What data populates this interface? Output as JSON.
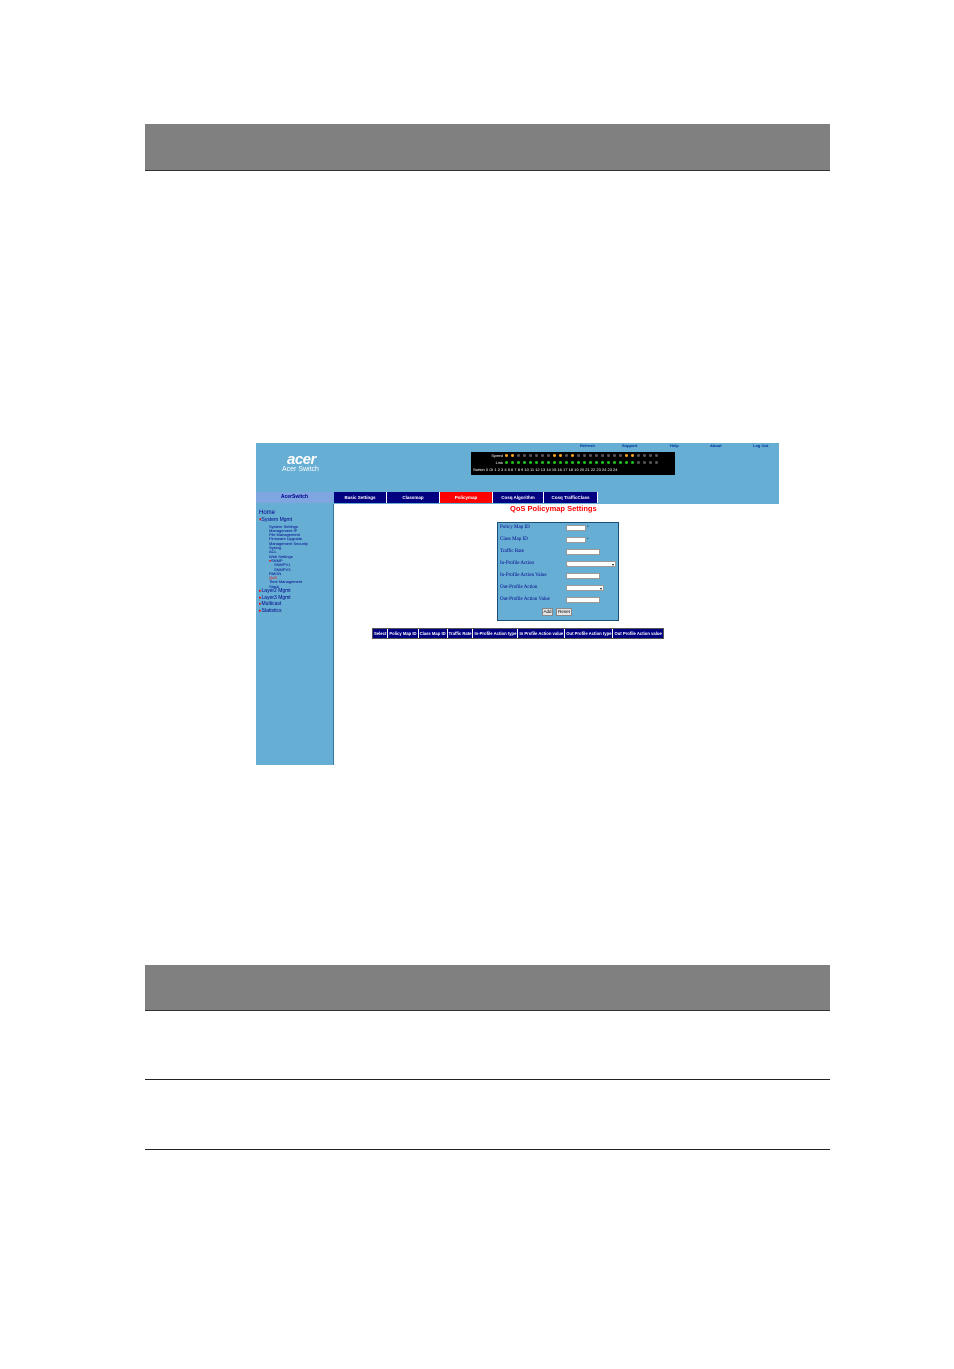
{
  "banner": {
    "logo": "acer",
    "subtitle": "Acer Switch",
    "links": [
      "Refresh",
      "Support",
      "Help",
      "About",
      "Log Out"
    ]
  },
  "port_panel": {
    "speed_label": "Speed",
    "link_label": "Link",
    "switch_label": "Switch 0 Gi",
    "ports": "1 2 3 4 5 6 7 8 9 10 11 12 13 14 15 16 17 18 19 20 21 22 23 24 23 24",
    "led_colors": {
      "speed": "#f0a020",
      "link": "#20c020",
      "off": "#555555"
    }
  },
  "sidebar": {
    "header": "AcerSwitch",
    "items": [
      {
        "label": "Home",
        "level": 0,
        "expanded": false
      },
      {
        "label": "System Mgmt",
        "level": 0,
        "expanded": true
      },
      {
        "label": "System Settings",
        "level": 1
      },
      {
        "label": "Management IP",
        "level": 1
      },
      {
        "label": "File Management",
        "level": 1
      },
      {
        "label": "Firmware Upgrade",
        "level": 1
      },
      {
        "label": "Management Security",
        "level": 1
      },
      {
        "label": "Syslog",
        "level": 1
      },
      {
        "label": "ACL",
        "level": 1
      },
      {
        "label": "Web Settings",
        "level": 1
      },
      {
        "label": "SNMP",
        "level": 1,
        "expanded": true
      },
      {
        "label": "SNMPV1",
        "level": 2
      },
      {
        "label": "SNMPV3",
        "level": 2
      },
      {
        "label": "RMON",
        "level": 1
      },
      {
        "label": "QoS",
        "level": 1,
        "active": true
      },
      {
        "label": "Time Management",
        "level": 1
      },
      {
        "label": "Stack",
        "level": 1
      },
      {
        "label": "Layer2 Mgmt",
        "level": 0,
        "expanded": false
      },
      {
        "label": "Layer3 Mgmt",
        "level": 0,
        "expanded": false
      },
      {
        "label": "Multicast",
        "level": 0,
        "expanded": false
      },
      {
        "label": "Statistics",
        "level": 0,
        "expanded": false
      }
    ]
  },
  "tabs": [
    {
      "label": "Basic Settings",
      "active": false
    },
    {
      "label": "Classmap",
      "active": false
    },
    {
      "label": "Policymap",
      "active": true
    },
    {
      "label": "Cosq Algorithm",
      "active": false
    },
    {
      "label": "Cosq TrafficClass",
      "active": false
    }
  ],
  "page_title": "QoS Policymap Settings",
  "form": {
    "policy_map_id": {
      "label": "Policy Map ID",
      "value": "",
      "required": "*"
    },
    "class_map_id": {
      "label": "Class Map ID",
      "value": "",
      "required": "*"
    },
    "traffic_rate": {
      "label": "Traffic Rate",
      "value": ""
    },
    "in_profile_action": {
      "label": "In-Profile Action",
      "value": "-"
    },
    "in_profile_action_value": {
      "label": "In-Profile Action Value",
      "value": ""
    },
    "out_profile_action": {
      "label": "Out-Profile Action",
      "value": ""
    },
    "out_profile_action_value": {
      "label": "Out-Profile Action Value",
      "value": ""
    },
    "add_label": "Add",
    "reset_label": "Reset"
  },
  "table": {
    "headers": [
      "Select",
      "Policy Map ID",
      "Class Map ID",
      "Traffic Rate",
      "In-Profile Action type",
      "In Profile Action value",
      "Out Profile Action type",
      "Out Profile Action value"
    ]
  },
  "colors": {
    "frame": "#66aed3",
    "navy": "#000080",
    "active_tab": "#ff0000",
    "title": "#ff0000",
    "doc_bar": "#808080"
  }
}
